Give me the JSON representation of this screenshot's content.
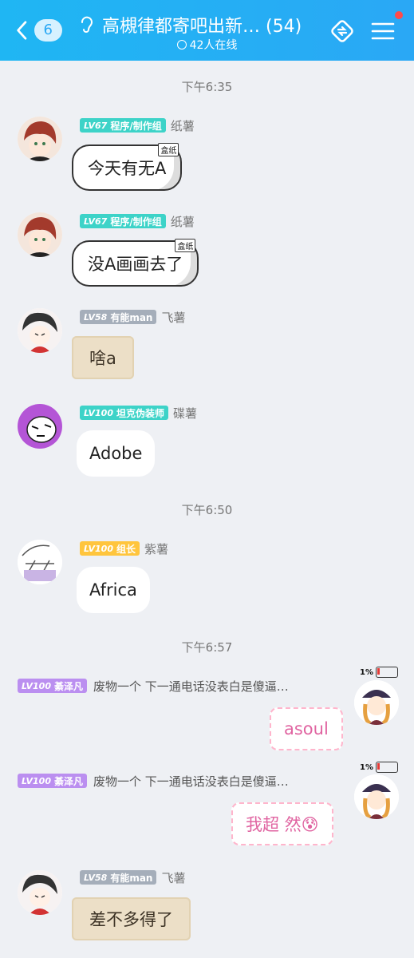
{
  "header": {
    "unread_count": "6",
    "title": "高槻律都寄吧出新… (54)",
    "online": "42人在线"
  },
  "times": [
    "下午6:35",
    "下午6:50",
    "下午6:57"
  ],
  "messages": [
    {
      "level": "LV67",
      "role": "程序/制作组",
      "nick": "纸薯",
      "text": "今天有无A",
      "tag": "盒纸"
    },
    {
      "level": "LV67",
      "role": "程序/制作组",
      "nick": "纸薯",
      "text": "没A画画去了",
      "tag": "盒纸"
    },
    {
      "level": "LV58",
      "role": "有能man",
      "nick": "飞薯",
      "text": "啥a"
    },
    {
      "level": "LV100",
      "role": "坦克伪装师",
      "nick": "碟薯",
      "text": "Adobe"
    },
    {
      "level": "LV100",
      "role": "组长",
      "nick": "紫薯",
      "text": "Africa"
    },
    {
      "level": "LV100",
      "role": "綦泽凡",
      "nick": "废物一个 下一通电话没表白是傻逼…",
      "text": "asoul",
      "battery": "1%"
    },
    {
      "level": "LV100",
      "role": "綦泽凡",
      "nick": "废物一个 下一通电话没表白是傻逼…",
      "text": "我超 然😰",
      "battery": "1%"
    },
    {
      "level": "LV58",
      "role": "有能man",
      "nick": "飞薯",
      "text": "差不多得了"
    }
  ],
  "icons": {
    "back": "chevron-left-icon",
    "ear": "ear-icon",
    "online": "circle-icon",
    "switch": "link-switch-icon",
    "menu": "menu-icon"
  },
  "colors": {
    "header": "#2aa8f5",
    "badge_teal": "#3dd3c8",
    "badge_gray": "#a5aeba",
    "badge_yellow": "#ffc53d",
    "badge_purple": "#bb8ff0"
  }
}
